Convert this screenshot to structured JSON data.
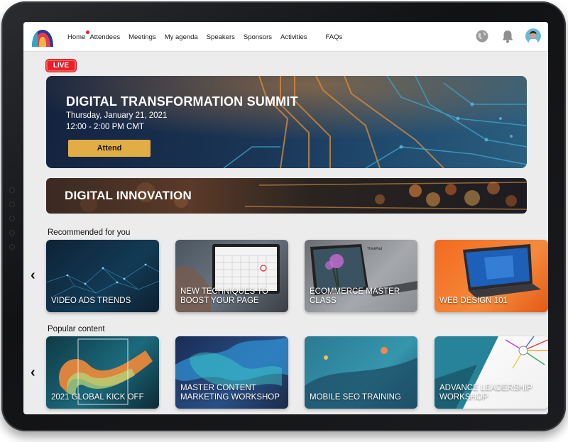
{
  "nav": {
    "items": [
      {
        "label": "Home",
        "active": true
      },
      {
        "label": "Attendees"
      },
      {
        "label": "Meetings"
      },
      {
        "label": "My agenda"
      },
      {
        "label": "Speakers"
      },
      {
        "label": "Sponsors"
      },
      {
        "label": "Activities"
      },
      {
        "label": "FAQs"
      }
    ],
    "icons": [
      "globe-icon",
      "bell-icon",
      "user-avatar"
    ]
  },
  "live_badge": "LIVE",
  "hero": {
    "title": "DIGITAL TRANSFORMATION SUMMIT",
    "date": "Thursday, January 21, 2021",
    "time": "12:00 - 2:00 PM CMT",
    "button": "Attend"
  },
  "banner": {
    "title": "DIGITAL INNOVATION"
  },
  "recommended": {
    "title": "Recommended for you",
    "cards": [
      {
        "label": "VIDEO ADS TRENDS"
      },
      {
        "label": "NEW TECHNIQUES TO BOOST YOUR PAGE"
      },
      {
        "label": "ECOMMERCE MASTER CLASS"
      },
      {
        "label": "WEB DESIGN 101"
      }
    ]
  },
  "popular": {
    "title": "Popular content",
    "cards": [
      {
        "label": "2021 GLOBAL KICK OFF"
      },
      {
        "label": "MASTER CONTENT MARKETING WORKSHOP"
      },
      {
        "label": "MOBILE SEO TRAINING"
      },
      {
        "label": "ADVANCE LEADERSHIP WORKSHOP"
      }
    ]
  },
  "colors": {
    "accent": "#e3ad45",
    "live": "#e8202a",
    "nav_dot": "#e8202a"
  }
}
